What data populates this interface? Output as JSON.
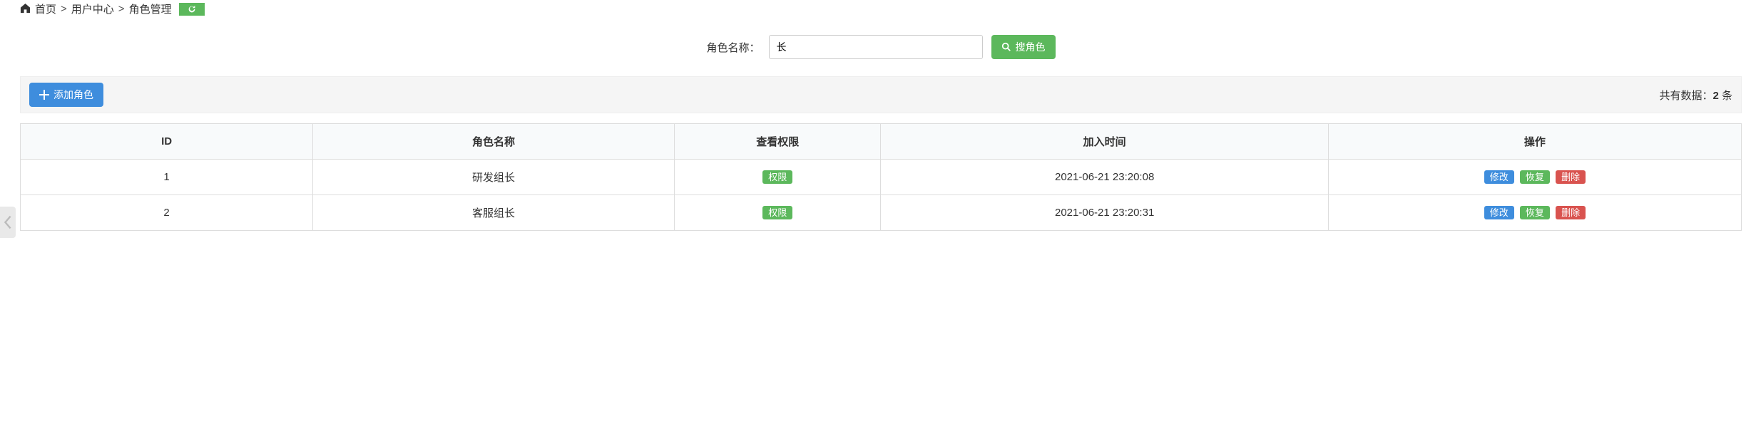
{
  "breadcrumb": {
    "home": "首页",
    "mid": "用户中心",
    "last": "角色管理"
  },
  "search": {
    "label": "角色名称：",
    "value": "长",
    "button": "搜角色"
  },
  "toolbar": {
    "add": "添加角色",
    "total_prefix": "共有数据：",
    "total_count": "2",
    "total_suffix": " 条"
  },
  "table": {
    "headers": {
      "id": "ID",
      "name": "角色名称",
      "perm": "查看权限",
      "time": "加入时间",
      "ops": "操作"
    },
    "perm_badge": "权限",
    "ops": {
      "edit": "修改",
      "restore": "恢复",
      "delete": "删除"
    },
    "rows": [
      {
        "id": "1",
        "name": "研发组长",
        "time": "2021-06-21 23:20:08"
      },
      {
        "id": "2",
        "name": "客服组长",
        "time": "2021-06-21 23:20:31"
      }
    ]
  }
}
